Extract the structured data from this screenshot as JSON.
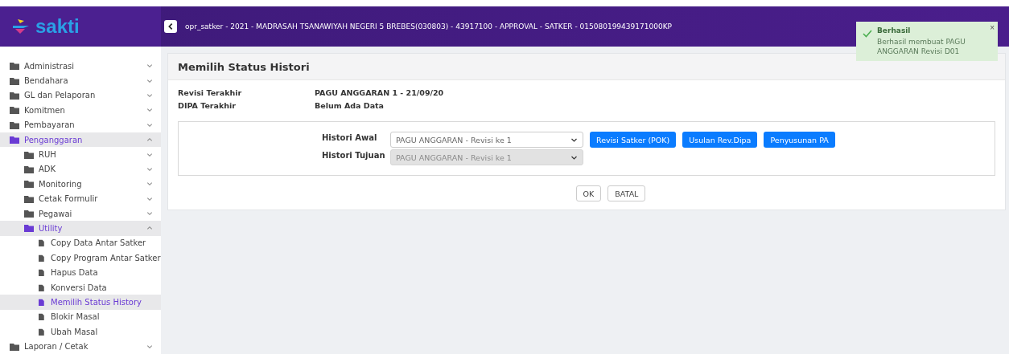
{
  "header": {
    "logo": "sakti",
    "context": "opr_satker - 2021 - MADRASAH TSANAWIYAH NEGERI 5 BREBES(030803) - 43917100 - APPROVAL - SATKER - 015080199439171000KP"
  },
  "sidebar": {
    "items": [
      {
        "label": "Administrasi",
        "kind": "folder",
        "expanded": false,
        "selected": false
      },
      {
        "label": "Bendahara",
        "kind": "folder",
        "expanded": false,
        "selected": false
      },
      {
        "label": "GL dan Pelaporan",
        "kind": "folder",
        "expanded": false,
        "selected": false
      },
      {
        "label": "Komitmen",
        "kind": "folder",
        "expanded": false,
        "selected": false
      },
      {
        "label": "Pembayaran",
        "kind": "folder",
        "expanded": false,
        "selected": false
      },
      {
        "label": "Penganggaran",
        "kind": "folder",
        "expanded": true,
        "selected": true,
        "children": [
          {
            "label": "RUH",
            "kind": "folder",
            "expanded": false,
            "selected": false
          },
          {
            "label": "ADK",
            "kind": "folder",
            "expanded": false,
            "selected": false
          },
          {
            "label": "Monitoring",
            "kind": "folder",
            "expanded": false,
            "selected": false
          },
          {
            "label": "Cetak Formulir",
            "kind": "folder",
            "expanded": false,
            "selected": false
          },
          {
            "label": "Pegawai",
            "kind": "folder",
            "expanded": false,
            "selected": false
          },
          {
            "label": "Utility",
            "kind": "folder",
            "expanded": true,
            "selected": true,
            "children": [
              {
                "label": "Copy Data Antar Satker",
                "kind": "page",
                "selected": false
              },
              {
                "label": "Copy Program Antar Satker",
                "kind": "page",
                "selected": false
              },
              {
                "label": "Hapus Data",
                "kind": "page",
                "selected": false
              },
              {
                "label": "Konversi Data",
                "kind": "page",
                "selected": false
              },
              {
                "label": "Memilih Status History",
                "kind": "page",
                "selected": true
              },
              {
                "label": "Blokir Masal",
                "kind": "page",
                "selected": false
              },
              {
                "label": "Ubah Masal",
                "kind": "page",
                "selected": false
              }
            ]
          }
        ]
      },
      {
        "label": "Laporan / Cetak",
        "kind": "folder",
        "expanded": false,
        "selected": false
      }
    ]
  },
  "page": {
    "title": "Memilih Status Histori",
    "info": [
      {
        "label": "Revisi Terakhir",
        "value": "PAGU ANGGARAN 1 - 21/09/20"
      },
      {
        "label": "DIPA Terakhir",
        "value": "Belum Ada Data"
      }
    ],
    "fields": [
      {
        "label": "Histori Awal",
        "value": "PAGU ANGGARAN - Revisi ke 1",
        "disabled": false
      },
      {
        "label": "Histori Tujuan",
        "value": "PAGU ANGGARAN - Revisi ke 1",
        "disabled": true
      }
    ],
    "action_buttons": [
      "Revisi Satker (POK)",
      "Usulan Rev.Dipa",
      "Penyusunan PA"
    ],
    "buttons": [
      "OK",
      "BATAL"
    ]
  },
  "toast": {
    "title": "Berhasil",
    "message": "Berhasil membuat PAGU ANGGARAN Revisi D01",
    "close": "×"
  }
}
